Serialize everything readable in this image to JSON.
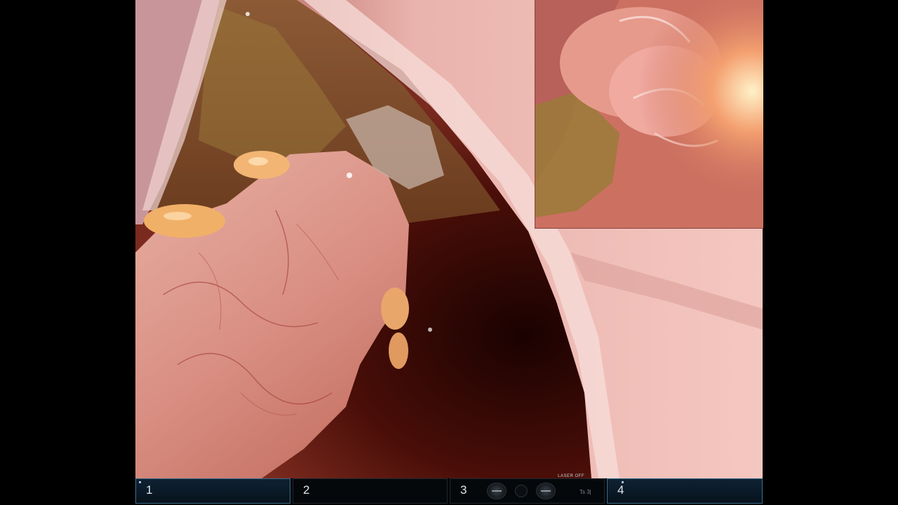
{
  "status_bar": {
    "arms": [
      {
        "number": "1",
        "active": true
      },
      {
        "number": "2",
        "active": false
      },
      {
        "number": "3",
        "active": false
      },
      {
        "number": "4",
        "active": true
      }
    ],
    "laser_status": "LASER OFF",
    "tool_tag": "Ts 3|"
  },
  "colors": {
    "tissue_pink": "#e2a49a",
    "wall_pink": "#f0b8b0",
    "cavity_dark": "#3a0906",
    "fat_yellow": "#f1b068",
    "active_arm_border": "#3d6d8c"
  }
}
